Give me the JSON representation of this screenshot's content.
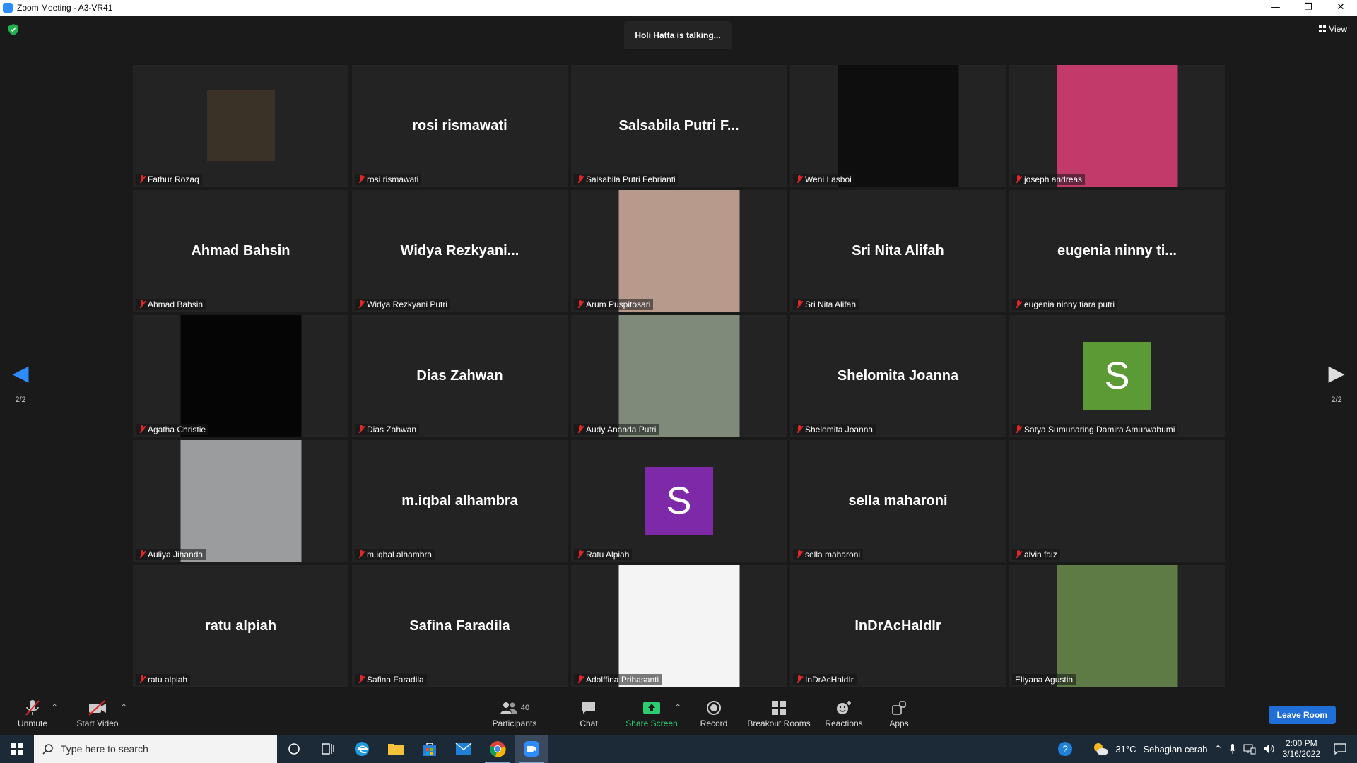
{
  "window": {
    "title": "Zoom Meeting - A3-VR41",
    "minimize": "—",
    "restore": "❐",
    "close": "✕"
  },
  "meeting": {
    "talking_banner": "Holi Hatta is talking...",
    "view_label": "View",
    "page_left": "2/2",
    "page_right": "2/2"
  },
  "tiles": [
    {
      "display": "",
      "label": "Fathur Rozaq",
      "kind": "photo",
      "color": "#3a3226"
    },
    {
      "display": "rosi rismawati",
      "label": "rosi rismawati",
      "kind": "text"
    },
    {
      "display": "Salsabila Putri F...",
      "label": "Salsabila Putri Febrianti",
      "kind": "text"
    },
    {
      "display": "",
      "label": "Weni Lasboi",
      "kind": "photo",
      "color": "#0e0e0e"
    },
    {
      "display": "",
      "label": "joseph andreas",
      "kind": "photo",
      "color": "#c23a6a"
    },
    {
      "display": "Ahmad Bahsin",
      "label": "Ahmad Bahsin",
      "kind": "text"
    },
    {
      "display": "Widya  Rezkyani...",
      "label": "Widya Rezkyani Putri",
      "kind": "text"
    },
    {
      "display": "",
      "label": "Arum Puspitosari",
      "kind": "photo",
      "color": "#b89a8c"
    },
    {
      "display": "Sri Nita Alifah",
      "label": "Sri Nita Alifah",
      "kind": "text"
    },
    {
      "display": "eugenia ninny ti...",
      "label": "eugenia ninny tiara putri",
      "kind": "text"
    },
    {
      "display": "",
      "label": "Agatha Christie",
      "kind": "photo",
      "color": "#050505"
    },
    {
      "display": "Dias Zahwan",
      "label": "Dias Zahwan",
      "kind": "text"
    },
    {
      "display": "",
      "label": "Audy Ananda Putri",
      "kind": "photo",
      "color": "#7f8a7a"
    },
    {
      "display": "Shelomita Joanna",
      "label": "Shelomita Joanna",
      "kind": "text"
    },
    {
      "display": "S",
      "label": "Satya Sumunaring Damira Amurwabumi",
      "kind": "avatar",
      "color": "#5b9a35"
    },
    {
      "display": "",
      "label": "Auliya Jihanda",
      "kind": "photo",
      "color": "#9a9c9e"
    },
    {
      "display": "m.iqbal alhambra",
      "label": "m.iqbal alhambra",
      "kind": "text"
    },
    {
      "display": "S",
      "label": "Ratu Alpiah",
      "kind": "avatar",
      "color": "#7e2aa8"
    },
    {
      "display": "sella maharoni",
      "label": "sella maharoni",
      "kind": "text"
    },
    {
      "display": "",
      "label": "alvin faiz",
      "kind": "blank"
    },
    {
      "display": "ratu alpiah",
      "label": "ratu alpiah",
      "kind": "text"
    },
    {
      "display": "Safina Faradila",
      "label": "Safina Faradila",
      "kind": "text"
    },
    {
      "display": "",
      "label": "Adolffina Prihasanti",
      "kind": "photo",
      "color": "#f4f4f4"
    },
    {
      "display": "InDrAcHaldIr",
      "label": "InDrAcHaldIr",
      "kind": "text"
    },
    {
      "display": "",
      "label": "Eliyana Agustin",
      "kind": "photo",
      "color": "#5e7a45",
      "unmuted": true
    }
  ],
  "toolbar": {
    "unmute": "Unmute",
    "start_video": "Start Video",
    "participants": "Participants",
    "participants_count": "40",
    "chat": "Chat",
    "share_screen": "Share Screen",
    "record": "Record",
    "breakout": "Breakout Rooms",
    "reactions": "Reactions",
    "apps": "Apps",
    "leave": "Leave Room"
  },
  "taskbar": {
    "search_placeholder": "Type here to search",
    "weather_temp": "31°C",
    "weather_desc": "Sebagian cerah",
    "time": "2:00 PM",
    "date": "3/16/2022"
  }
}
